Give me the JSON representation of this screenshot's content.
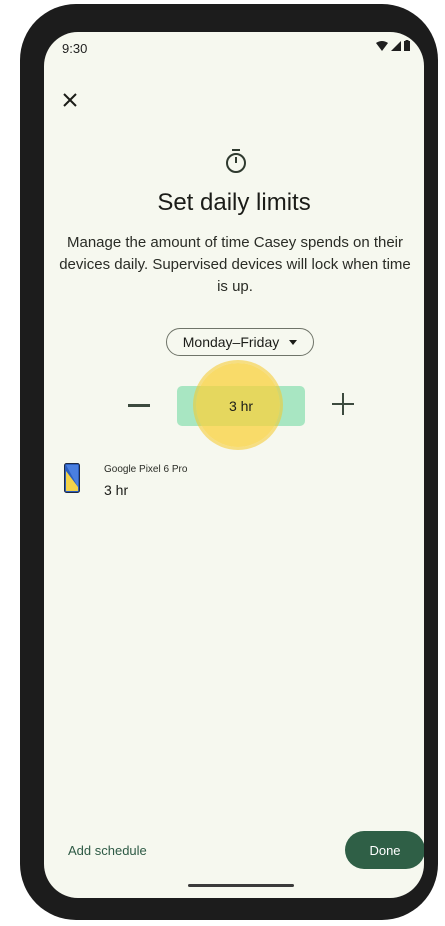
{
  "status_bar": {
    "time": "9:30"
  },
  "page": {
    "title": "Set daily limits",
    "description": "Manage the amount of time Casey spends on their devices daily. Supervised devices will lock when time is up."
  },
  "day_selector": {
    "selected": "Monday–Friday"
  },
  "stepper": {
    "value": "3 hr"
  },
  "device": {
    "name": "Google Pixel 6 Pro",
    "limit": "3 hr"
  },
  "footer": {
    "add_schedule": "Add schedule",
    "done": "Done"
  },
  "colors": {
    "accent": "#2f5f46",
    "value_bg": "#a8e6c2",
    "screen_bg": "#f6f8ef",
    "highlight": "#fad23c"
  },
  "icons": [
    "close-icon",
    "timer-icon",
    "minus-icon",
    "plus-icon",
    "dropdown-caret-icon",
    "phone-device-icon",
    "wifi-icon",
    "signal-icon",
    "battery-icon"
  ]
}
